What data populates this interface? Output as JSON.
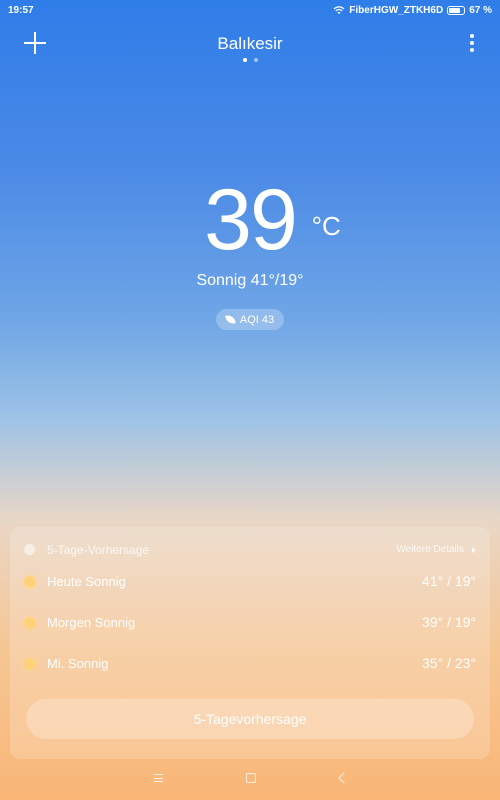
{
  "status_bar": {
    "time": "19:57",
    "network": "FiberHGW_ZTKH6D",
    "battery": "67 %",
    "battery_level": 0.67
  },
  "header": {
    "city": "Balıkesir",
    "pages": 2,
    "active_page": 1
  },
  "current": {
    "temperature": "39",
    "unit": "°C",
    "condition": "Sonnig",
    "high_low": "41°/19°",
    "aqi": "AQI 43"
  },
  "forecast": {
    "title": "5-Tage-Vorhersage",
    "details_link": "Weitere Details",
    "days": [
      {
        "day": "Heute",
        "condition": "Sonnig",
        "temps": "41° / 19°"
      },
      {
        "day": "Morgen",
        "condition": "Sonnig",
        "temps": "39° / 19°"
      },
      {
        "day": "Mi.",
        "condition": "Sonnig",
        "temps": "35° / 23°"
      }
    ],
    "button": "5-Tagevorhersage"
  },
  "icons": {
    "add": "plus-icon",
    "more": "more-vertical-icon",
    "wifi": "wifi-icon",
    "battery": "battery-icon",
    "aqi": "leaf-icon",
    "weather": "sun-icon",
    "nav": [
      "menu-icon",
      "home-icon",
      "back-icon"
    ]
  }
}
